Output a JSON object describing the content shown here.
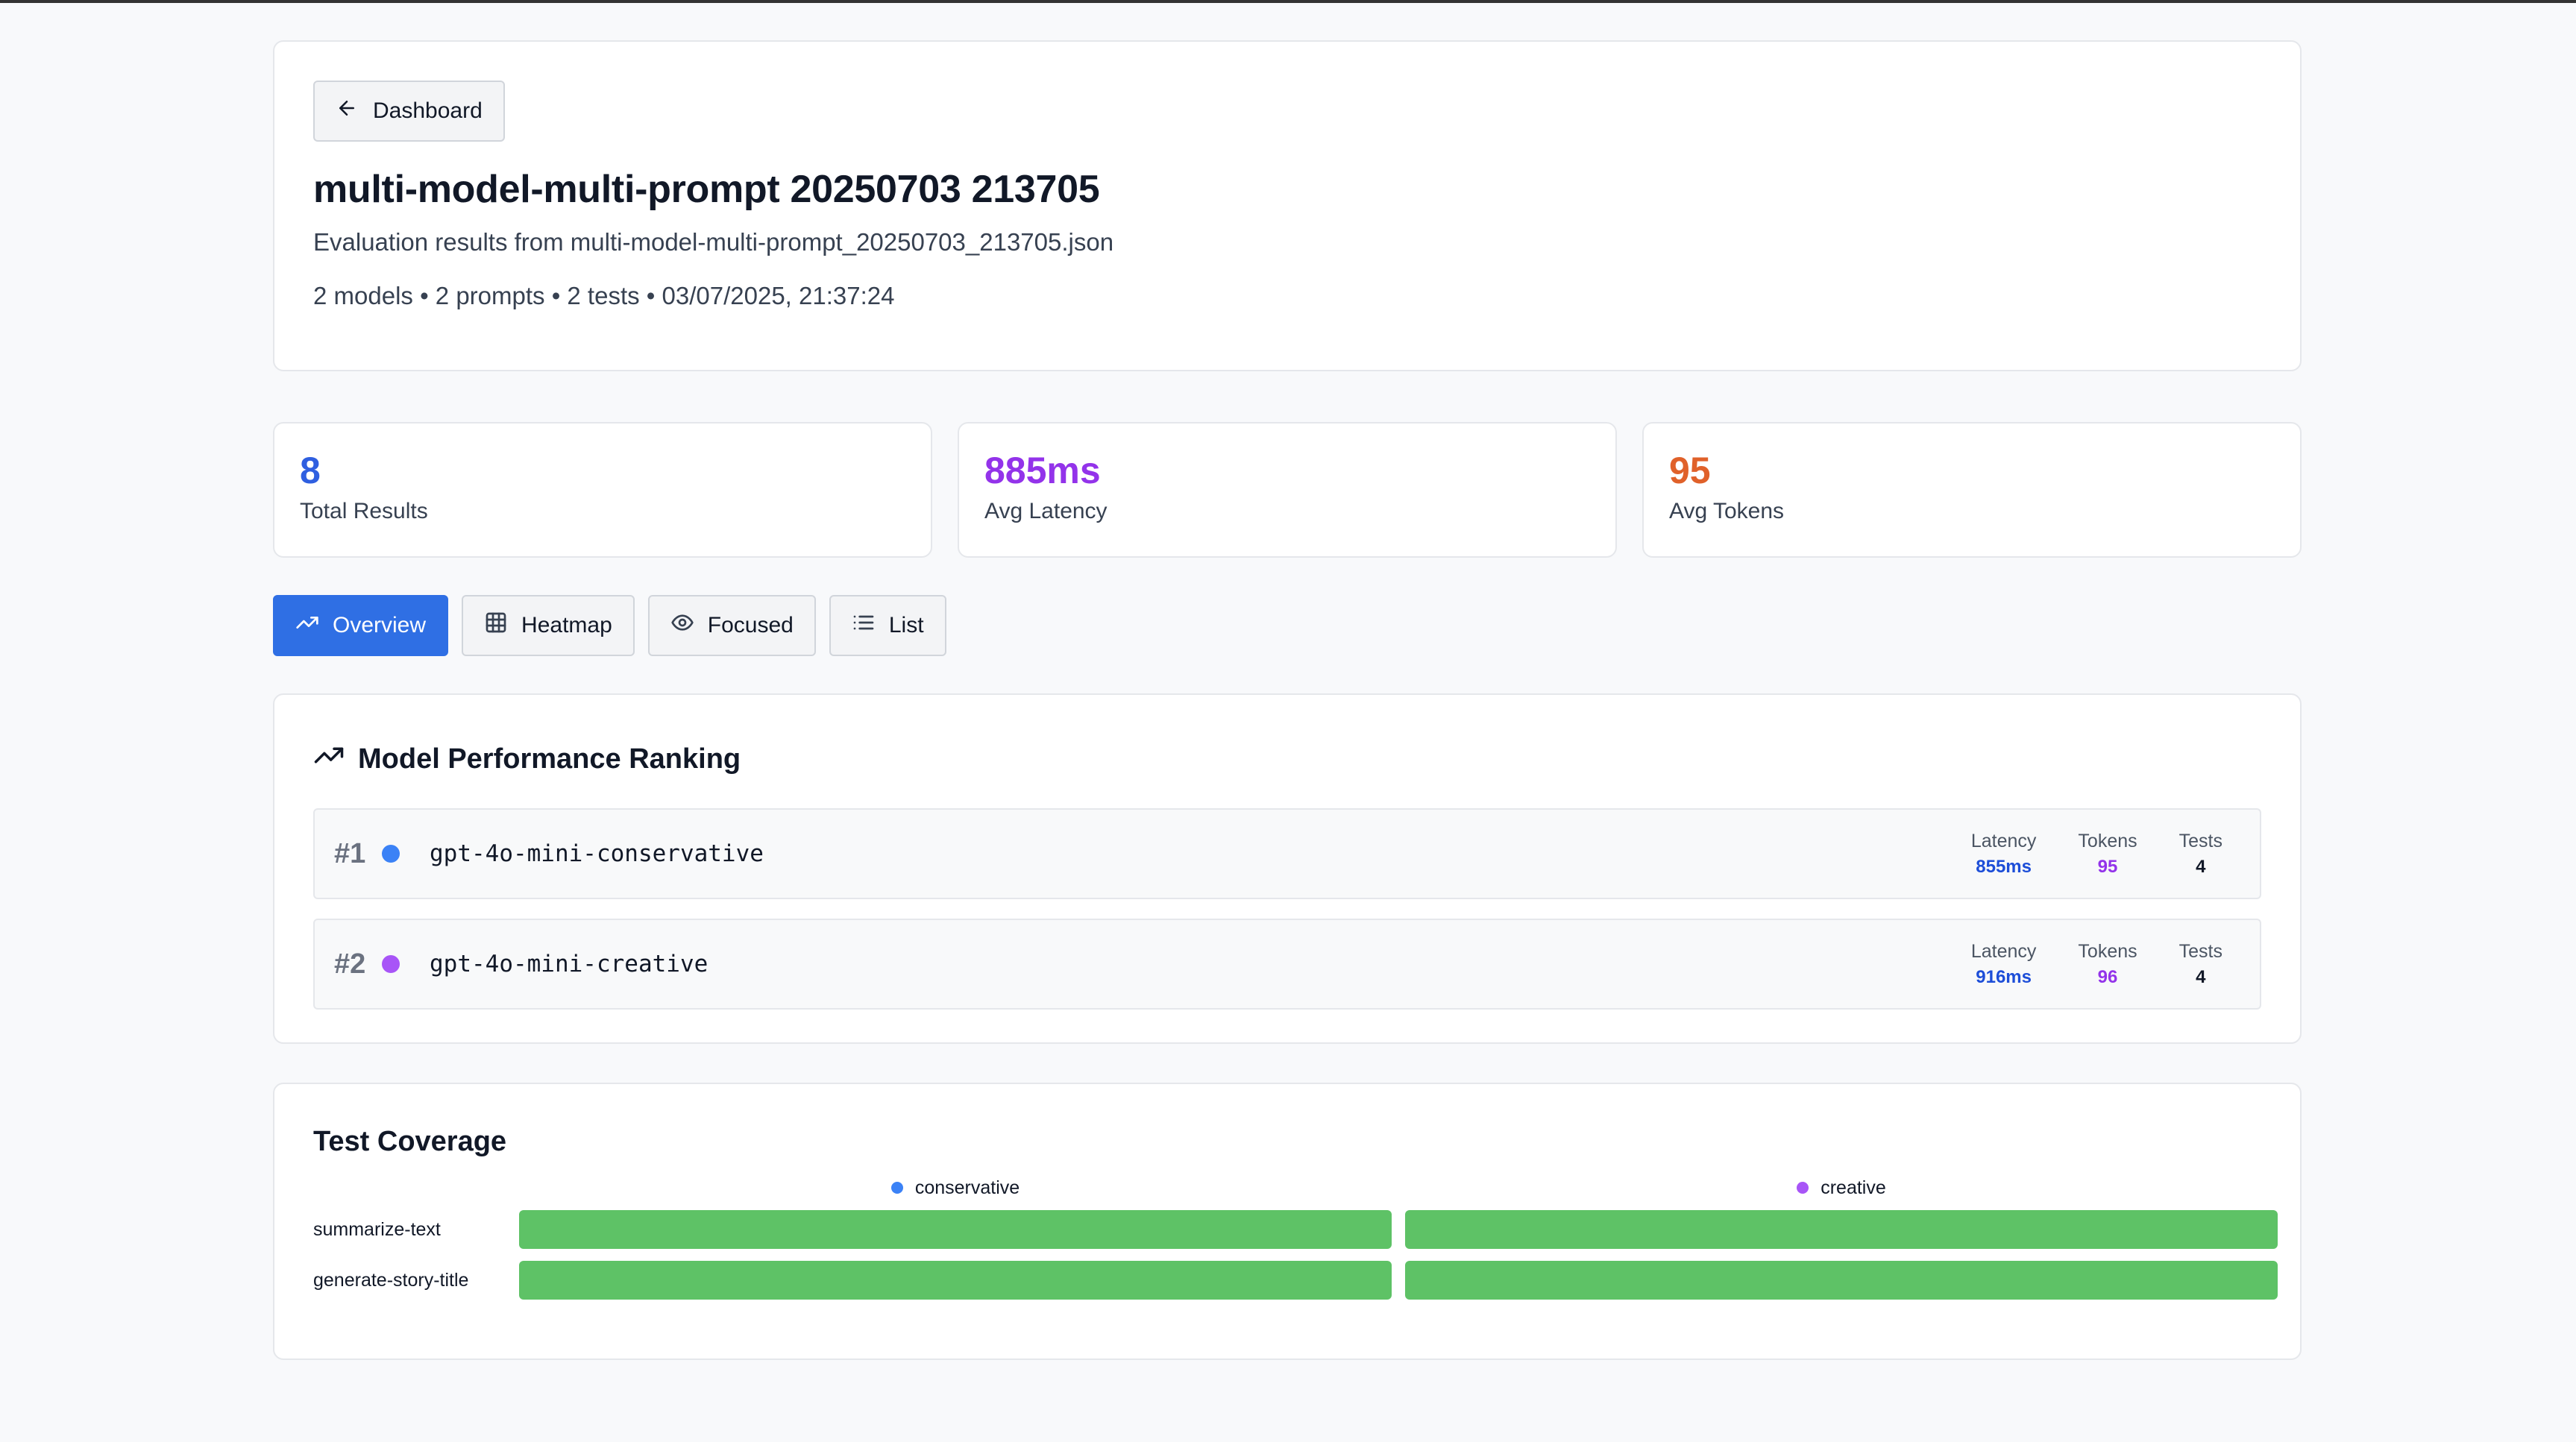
{
  "header": {
    "back_label": "Dashboard",
    "title": "multi-model-multi-prompt 20250703 213705",
    "subtitle": "Evaluation results from multi-model-multi-prompt_20250703_213705.json",
    "meta": "2 models • 2 prompts • 2 tests • 03/07/2025, 21:37:24"
  },
  "stats": [
    {
      "value": "8",
      "label": "Total Results",
      "color": "#2f5fe0"
    },
    {
      "value": "885ms",
      "label": "Avg Latency",
      "color": "#9333ea"
    },
    {
      "value": "95",
      "label": "Avg Tokens",
      "color": "#e0612a"
    }
  ],
  "tabs": [
    {
      "label": "Overview",
      "icon": "trending-up-icon",
      "active": true
    },
    {
      "label": "Heatmap",
      "icon": "grid-icon",
      "active": false
    },
    {
      "label": "Focused",
      "icon": "eye-icon",
      "active": false
    },
    {
      "label": "List",
      "icon": "list-icon",
      "active": false
    }
  ],
  "ranking": {
    "title": "Model Performance Ranking",
    "icon": "trending-up-icon",
    "latency_label": "Latency",
    "tokens_label": "Tokens",
    "tests_label": "Tests",
    "models": [
      {
        "rank": "#1",
        "name": "gpt-4o-mini-conservative",
        "color": "#3b82f6",
        "latency": "855ms",
        "tokens": "95",
        "tests": "4"
      },
      {
        "rank": "#2",
        "name": "gpt-4o-mini-creative",
        "color": "#a855f7",
        "latency": "916ms",
        "tokens": "96",
        "tests": "4"
      }
    ]
  },
  "coverage": {
    "title": "Test Coverage",
    "columns": [
      {
        "label": "conservative",
        "color": "#3b82f6"
      },
      {
        "label": "creative",
        "color": "#a855f7"
      }
    ],
    "rows": [
      {
        "label": "summarize-text",
        "cells": [
          "pass",
          "pass"
        ]
      },
      {
        "label": "generate-story-title",
        "cells": [
          "pass",
          "pass"
        ]
      }
    ],
    "pass_color": "#5ec266"
  },
  "colors": {
    "latency_value": "#1d4ed8",
    "tokens_value": "#9333ea",
    "tests_value": "#111827",
    "accent": "#2f6fe4"
  }
}
